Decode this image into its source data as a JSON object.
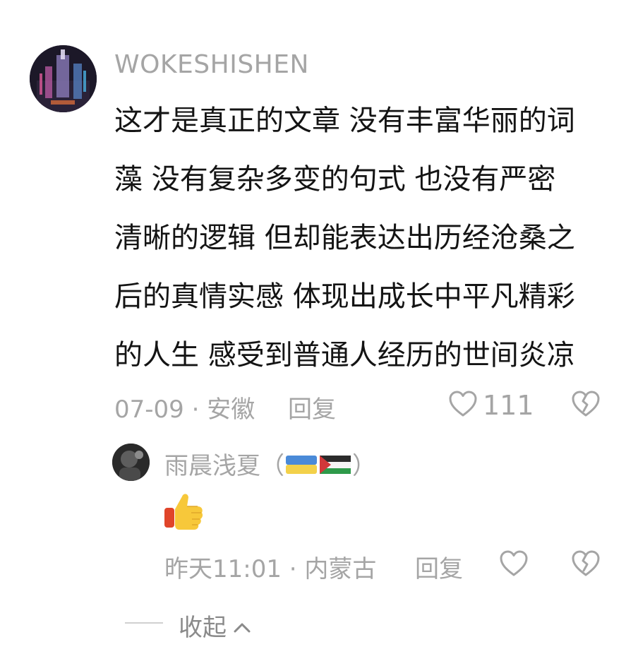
{
  "comment": {
    "username": "WOKESHISHEN",
    "text_lines": [
      "这才是真正的文章 没有丰富华丽的词",
      "藻 没有复杂多变的句式 也没有严密",
      "清晰的逻辑 但却能表达出历经沧桑之",
      "后的真情实感 体现出成长中平凡精彩",
      "的人生 感受到普通人经历的世间炎凉"
    ],
    "meta": "07-09 · 安徽",
    "reply_label": "回复",
    "like_count": "111"
  },
  "reply": {
    "username": "雨晨浅夏",
    "paren_open": "（",
    "paren_close": "）",
    "flags": [
      "ukraine-flag",
      "palestine-flag"
    ],
    "emoji": "thumbs-up",
    "meta": "昨天11:01 · 内蒙古",
    "reply_label": "回复"
  },
  "collapse": {
    "label": "收起"
  },
  "colors": {
    "text_primary": "#141414",
    "text_secondary": "#a5a5a5",
    "background": "#ffffff"
  }
}
